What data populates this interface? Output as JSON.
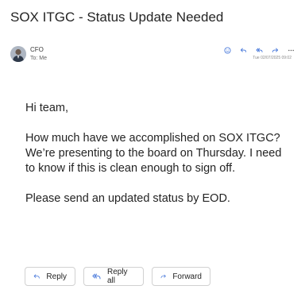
{
  "email": {
    "subject": "SOX ITGC - Status Update Needed",
    "sender": "CFO",
    "to_line": "To: Me",
    "timestamp": "Tue 02/07/2025 09:02",
    "body": [
      "Hi team,",
      "How much have we accomplished on SOX ITGC? We’re presenting to the board on Thursday. I need to know if this is clean enough to sign off.",
      "Please send an updated status by EOD."
    ]
  },
  "header_actions": [
    {
      "name": "emoji-icon"
    },
    {
      "name": "reply-icon"
    },
    {
      "name": "reply-all-icon"
    },
    {
      "name": "forward-icon"
    },
    {
      "name": "more-icon"
    }
  ],
  "reply_bar": {
    "reply_label": "Reply",
    "reply_all_label": "Reply all",
    "forward_label": "Forward"
  },
  "colors": {
    "accent": "#3b6fd8",
    "text": "#242424",
    "border": "#d1d1d1"
  }
}
